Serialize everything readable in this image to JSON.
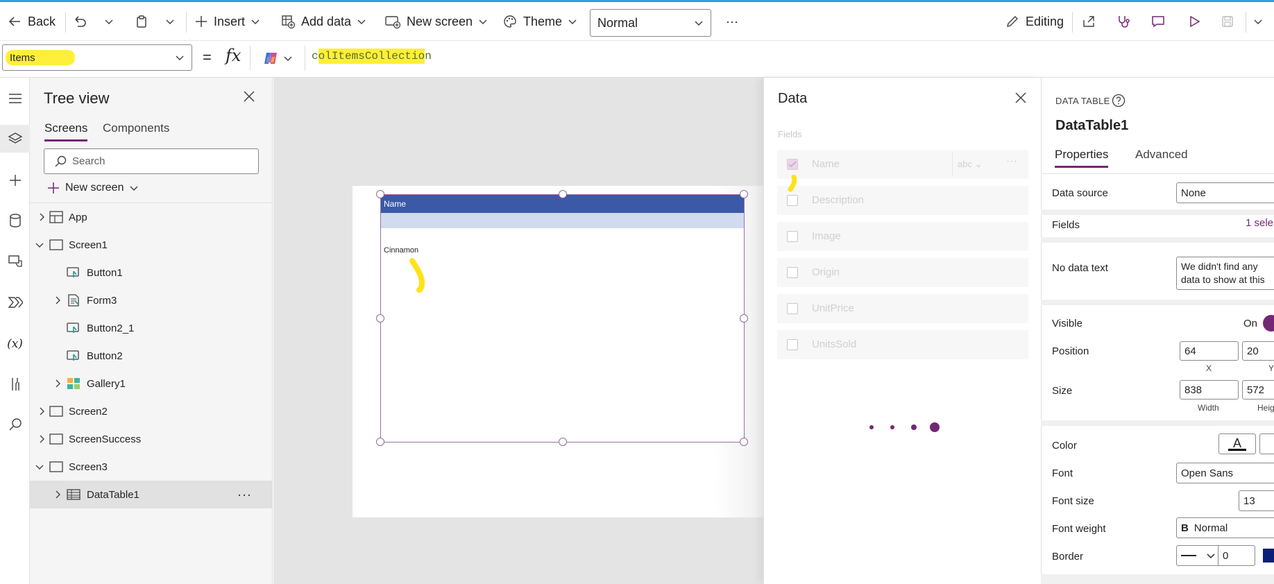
{
  "toolbar": {
    "back": "Back",
    "insert": "Insert",
    "add_data": "Add data",
    "new_screen": "New screen",
    "theme": "Theme",
    "mode": "Normal",
    "more": "···",
    "editing": "Editing"
  },
  "formula": {
    "property": "Items",
    "eq": "=",
    "fx": "fx",
    "text_pre": "c",
    "text_hl": "olItemsCollectio",
    "text_post": "n"
  },
  "tree": {
    "title": "Tree view",
    "tabs": [
      "Screens",
      "Components"
    ],
    "search_placeholder": "Search",
    "new_screen": "New screen",
    "nodes": [
      "App",
      "Screen1",
      "Button1",
      "Form3",
      "Button2_1",
      "Button2",
      "Gallery1",
      "Screen2",
      "ScreenSuccess",
      "Screen3",
      "DataTable1"
    ],
    "more": "···"
  },
  "canvas": {
    "header": "Name",
    "cell": "Cinnamon"
  },
  "data_panel": {
    "title": "Data",
    "fields_label": "Fields",
    "fields": [
      "Name",
      "Description",
      "Image",
      "Origin",
      "UnitPrice",
      "UnitsSold"
    ],
    "type": "abc",
    "more": "···"
  },
  "properties": {
    "type_label": "DATA TABLE",
    "name": "DataTable1",
    "tabs": [
      "Properties",
      "Advanced"
    ],
    "data_source_label": "Data source",
    "data_source": "None",
    "fields_label": "Fields",
    "fields_value": "1 sele",
    "no_data_label": "No data text",
    "no_data_line1": "We didn't find any",
    "no_data_line2": "data to show at this",
    "visible_label": "Visible",
    "visible_value": "On",
    "position_label": "Position",
    "pos_x": "64",
    "pos_y": "20",
    "x_label": "X",
    "y_label": "Y",
    "size_label": "Size",
    "width": "838",
    "height": "572",
    "width_label": "Width",
    "height_label": "Heig",
    "color_label": "Color",
    "color_glyph": "A",
    "font_label": "Font",
    "font_value": "Open Sans",
    "font_size_label": "Font size",
    "font_size": "13",
    "font_weight_label": "Font weight",
    "font_weight_glyph": "B",
    "font_weight": "Normal",
    "border_label": "Border",
    "border_width": "0"
  },
  "colors": {
    "accent": "#742774",
    "header_blue": "#3b59a7",
    "row_blue": "#d1dbef",
    "highlight": "#ffef3a"
  }
}
